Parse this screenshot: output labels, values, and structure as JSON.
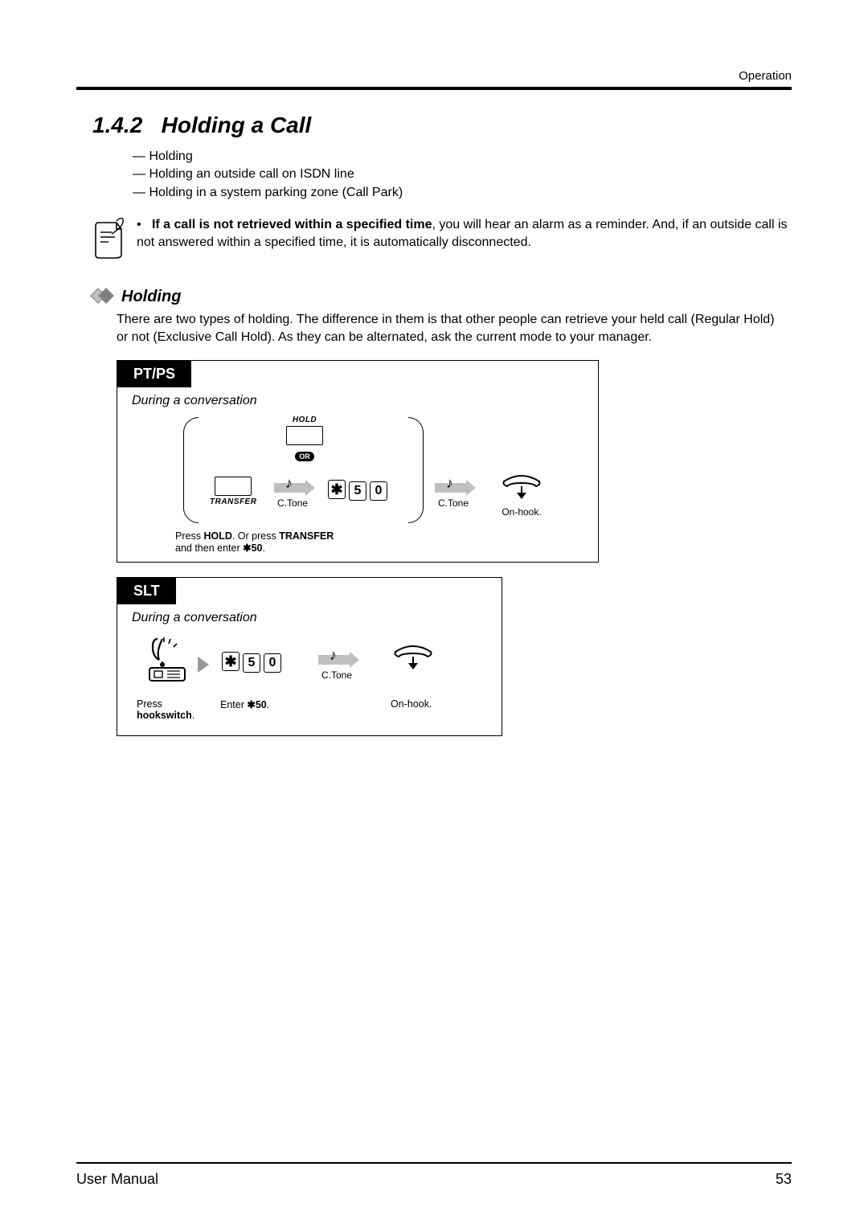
{
  "header": {
    "category": "Operation"
  },
  "section": {
    "number": "1.4.2",
    "title": "Holding a Call"
  },
  "toc": {
    "dash": "—",
    "items": [
      "Holding",
      "Holding an outside call on ISDN line",
      "Holding in a system parking zone (Call Park)"
    ]
  },
  "note": {
    "bullet": "•",
    "bold_lead": "If a call is not retrieved within a specified time",
    "rest": ", you will hear an alarm as a reminder. And, if an outside call is not answered within a specified time, it is automatically disconnected."
  },
  "sub": {
    "heading": "Holding",
    "paragraph": "There are two types of holding. The difference in them is that other people can retrieve your held call (Regular Hold) or not (Exclusive Call Hold). As they can be alternated, ask the current mode to your manager."
  },
  "keys": {
    "star": "✱",
    "five": "5",
    "zero": "0"
  },
  "labels": {
    "hold": "HOLD",
    "transfer": "TRANSFER",
    "or": "OR",
    "ctone": "C.Tone",
    "onhook": "On-hook."
  },
  "ptps": {
    "tab": "PT/PS",
    "context": "During a conversation",
    "caption_line1": "Press ",
    "caption_bold1": "HOLD",
    "caption_mid": ". Or press ",
    "caption_bold2": "TRANSFER",
    "caption_line2a": "and then enter ",
    "caption_code": "✱50",
    "caption_end": "."
  },
  "slt": {
    "tab": "SLT",
    "context": "During a conversation",
    "press": "Press",
    "hookswitch": "hookswitch",
    "enter": "Enter ",
    "code": "✱50",
    "period": ".",
    "onhook": "On-hook."
  },
  "footer": {
    "left": "User Manual",
    "page": "53"
  }
}
